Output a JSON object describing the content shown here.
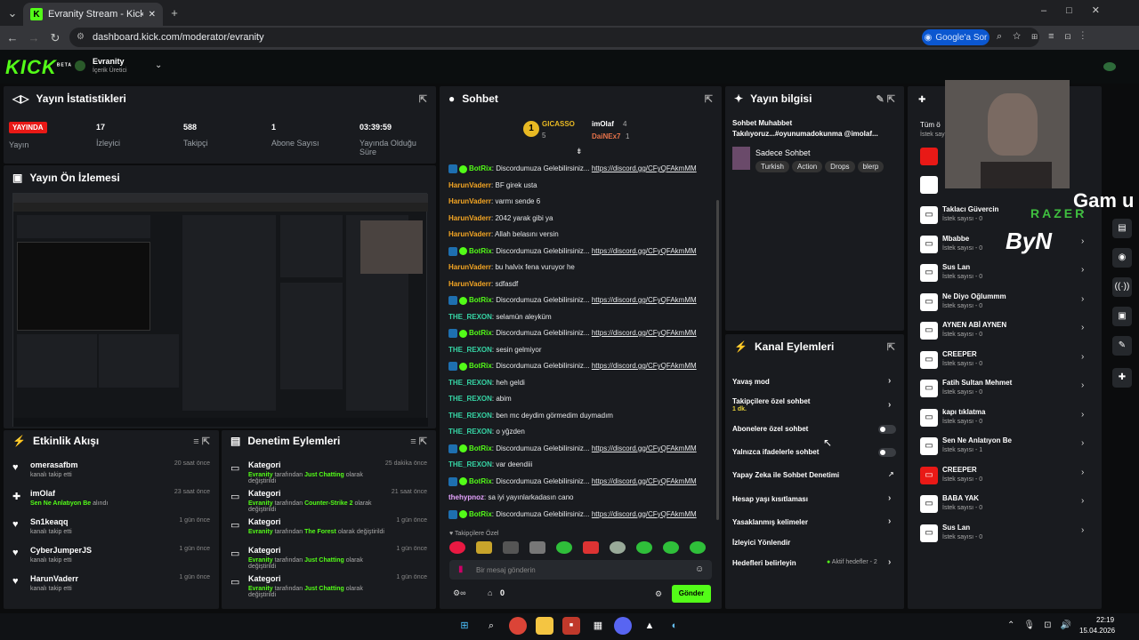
{
  "browser": {
    "tab_title": "Evranity Stream - Kick Dashboard",
    "url": "dashboard.kick.com/moderator/evranity",
    "google_btn": "Google'a Sor"
  },
  "kick": {
    "logo": "KICK",
    "beta": "BETA",
    "channel_name": "Evranity",
    "channel_role": "İçerik Üretici"
  },
  "stats": {
    "title": "Yayın İstatistikleri",
    "live_badge": "YAYINDA",
    "live_label": "Yayın",
    "viewers_value": "17",
    "viewers_label": "İzleyici",
    "followers_value": "588",
    "followers_label": "Takipçi",
    "subs_value": "1",
    "subs_label": "Abone Sayısı",
    "uptime_value": "03:39:59",
    "uptime_label1": "Yayında Olduğu",
    "uptime_label2": "Süre"
  },
  "preview": {
    "title": "Yayın Ön İzlemesi"
  },
  "activity": {
    "title": "Etkinlik Akışı",
    "items": [
      {
        "icon": "heart-icon",
        "name": "omerasafbm",
        "sub": "kanalı takip etti",
        "time": "20 saat önce"
      },
      {
        "icon": "gift-icon",
        "name": "imOlaf",
        "sub_green": "Sen Ne Anlatıyon Be",
        "sub": "alındı",
        "time": "23 saat önce"
      },
      {
        "icon": "heart-icon",
        "name": "Sn1keaqq",
        "sub": "kanalı takip etti",
        "time": "1 gün önce"
      },
      {
        "icon": "heart-icon",
        "name": "CyberJumperJS",
        "sub": "kanalı takip etti",
        "time": "1 gün önce"
      },
      {
        "icon": "heart-icon",
        "name": "HarunVaderr",
        "sub": "kanalı takip etti",
        "time": "1 gün önce"
      }
    ]
  },
  "moderation": {
    "title": "Denetim Eylemleri",
    "items": [
      {
        "name": "Kategori",
        "by": "Evranity",
        "mid": "tarafından",
        "cat": "Just Chatting",
        "end": "olarak değiştirildi",
        "time": "25 dakika önce"
      },
      {
        "name": "Kategori",
        "by": "Evranity",
        "mid": "tarafından",
        "cat": "Counter-Strike 2",
        "end": "olarak değiştirildi",
        "time": "21 saat önce"
      },
      {
        "name": "Kategori",
        "by": "Evranity",
        "mid": "tarafından",
        "cat": "The Forest",
        "end": "olarak değiştirildi",
        "time": "1 gün önce"
      },
      {
        "name": "Kategori",
        "by": "Evranity",
        "mid": "tarafından",
        "cat": "Just Chatting",
        "end": "olarak değiştirildi",
        "time": "1 gün önce"
      },
      {
        "name": "Kategori",
        "by": "Evranity",
        "mid": "tarafından",
        "cat": "Just Chatting",
        "end": "olarak değiştirildi",
        "time": "1 gün önce"
      }
    ]
  },
  "chat": {
    "title": "Sohbet",
    "leaders": {
      "first": "GICASSO",
      "first_count": "5",
      "second": "imOlaf",
      "second_count": "4",
      "third": "DaiNEx7",
      "third_count": "1"
    },
    "bot_msg": "Discordumuza Gelebilirsiniz...",
    "bot_link": "https://discord.gg/CFyQFAkmMM",
    "messages": [
      {
        "user": "BotRix",
        "color": "#53fc18",
        "text": "Discordumuza Gelebilirsiniz...",
        "link": "https://discord.gg/CFyQFAkmMM",
        "bot": true
      },
      {
        "user": "HarunVaderr",
        "color": "#f5a623",
        "text": "BF girek usta"
      },
      {
        "user": "HarunVaderr",
        "color": "#f5a623",
        "text": "varmı sende 6"
      },
      {
        "user": "HarunVaderr",
        "color": "#f5a623",
        "text": "2042 yarak gibi ya"
      },
      {
        "user": "HarunVaderr",
        "color": "#f5a623",
        "text": "Allah belasını versin"
      },
      {
        "user": "BotRix",
        "color": "#53fc18",
        "text": "Discordumuza Gelebilirsiniz...",
        "link": "https://discord.gg/CFyQFAkmMM",
        "bot": true
      },
      {
        "user": "HarunVaderr",
        "color": "#f5a623",
        "text": "bu halvix fena vuruyor he"
      },
      {
        "user": "HarunVaderr",
        "color": "#f5a623",
        "text": "sdfasdf"
      },
      {
        "user": "BotRix",
        "color": "#53fc18",
        "text": "Discordumuza Gelebilirsiniz...",
        "link": "https://discord.gg/CFyQFAkmMM",
        "bot": true
      },
      {
        "user": "THE_REXON",
        "color": "#36d6a6",
        "text": "selamün aleyküm"
      },
      {
        "user": "BotRix",
        "color": "#53fc18",
        "text": "Discordumuza Gelebilirsiniz...",
        "link": "https://discord.gg/CFyQFAkmMM",
        "bot": true
      },
      {
        "user": "THE_REXON",
        "color": "#36d6a6",
        "text": "sesin gelmiyor"
      },
      {
        "user": "BotRix",
        "color": "#53fc18",
        "text": "Discordumuza Gelebilirsiniz...",
        "link": "https://discord.gg/CFyQFAkmMM",
        "bot": true
      },
      {
        "user": "THE_REXON",
        "color": "#36d6a6",
        "text": "heh geldi"
      },
      {
        "user": "THE_REXON",
        "color": "#36d6a6",
        "text": "abim"
      },
      {
        "user": "THE_REXON",
        "color": "#36d6a6",
        "text": "ben mc deydim görmedim duymadım"
      },
      {
        "user": "THE_REXON",
        "color": "#36d6a6",
        "text": "o yğzden"
      },
      {
        "user": "BotRix",
        "color": "#53fc18",
        "text": "Discordumuza Gelebilirsiniz...",
        "link": "https://discord.gg/CFyQFAkmMM",
        "bot": true
      },
      {
        "user": "THE_REXON",
        "color": "#36d6a6",
        "text": "var deendiii"
      },
      {
        "user": "BotRix",
        "color": "#53fc18",
        "text": "Discordumuza Gelebilirsiniz...",
        "link": "https://discord.gg/CFyQFAkmMM",
        "bot": true
      },
      {
        "user": "thehypnoz",
        "color": "#e6a3ff",
        "text": "sa iyi yayınlarkadasın cano"
      },
      {
        "user": "BotRix",
        "color": "#53fc18",
        "text": "Discordumuza Gelebilirsiniz...",
        "link": "https://discord.gg/CFyQFAkmMM",
        "bot": true
      }
    ],
    "followers_only": "Takipçilere Özel",
    "input_placeholder": "Bir mesaj gönderin",
    "count": "0",
    "send": "Gönder"
  },
  "info": {
    "title": "Yayın bilgisi",
    "stream_title": "Sohbet Muhabbet Takılıyoruz...#oyunumadokunma @imolaf...",
    "category": "Sadece Sohbet",
    "tags": [
      "Turkish",
      "Action",
      "Drops",
      "blerp"
    ]
  },
  "actions": {
    "title": "Kanal Eylemleri",
    "slow": "Yavaş mod",
    "followers": "Takipçilere özel sohbet",
    "followers_sub": "1 dk.",
    "subs": "Abonelere özel sohbet",
    "emotes": "Yalnızca ifadelerle sohbet",
    "ai": "Yapay Zeka ile Sohbet Denetimi",
    "age": "Hesap yaşı kısıtlaması",
    "banned": "Yasaklanmış kelimeler",
    "raid": "İzleyici Yönlendir",
    "goals": "Hedefleri belirleyin",
    "goals_sub": "Aktif hedefler - 2"
  },
  "rewards": {
    "header": "Tüm ö",
    "header_sub": "İstek sayısı",
    "items": [
      {
        "name": "Taklacı Güvercin",
        "sub": "İstek sayısı - 0",
        "red": false
      },
      {
        "name": "Mbabbe",
        "sub": "İstek sayısı - 0",
        "red": false
      },
      {
        "name": "Sus Lan",
        "sub": "İstek sayısı - 0",
        "red": false
      },
      {
        "name": "Ne Diyo Oğlummm",
        "sub": "İstek sayısı - 0",
        "red": false
      },
      {
        "name": "AYNEN ABİ AYNEN",
        "sub": "İstek sayısı - 0",
        "red": false
      },
      {
        "name": "CREEPER",
        "sub": "İstek sayısı - 0",
        "red": false
      },
      {
        "name": "Fatih Sultan Mehmet",
        "sub": "İstek sayısı - 0",
        "red": false
      },
      {
        "name": "kapı tıklatma",
        "sub": "İstek sayısı - 0",
        "red": false
      },
      {
        "name": "Sen Ne Anlatıyon Be",
        "sub": "İstek sayısı - 1",
        "red": false
      },
      {
        "name": "CREEPER",
        "sub": "İstek sayısı - 0",
        "red": true
      },
      {
        "name": "BABA YAK",
        "sub": "İstek sayısı - 0",
        "red": false
      },
      {
        "name": "Sus Lan",
        "sub": "İstek sayısı - 0",
        "red": false
      }
    ]
  },
  "overlay": {
    "razer": "RAZER",
    "byn": "ByN",
    "gam": "Gam u"
  },
  "taskbar": {
    "time": "22:19",
    "date": "15.04.2026"
  }
}
